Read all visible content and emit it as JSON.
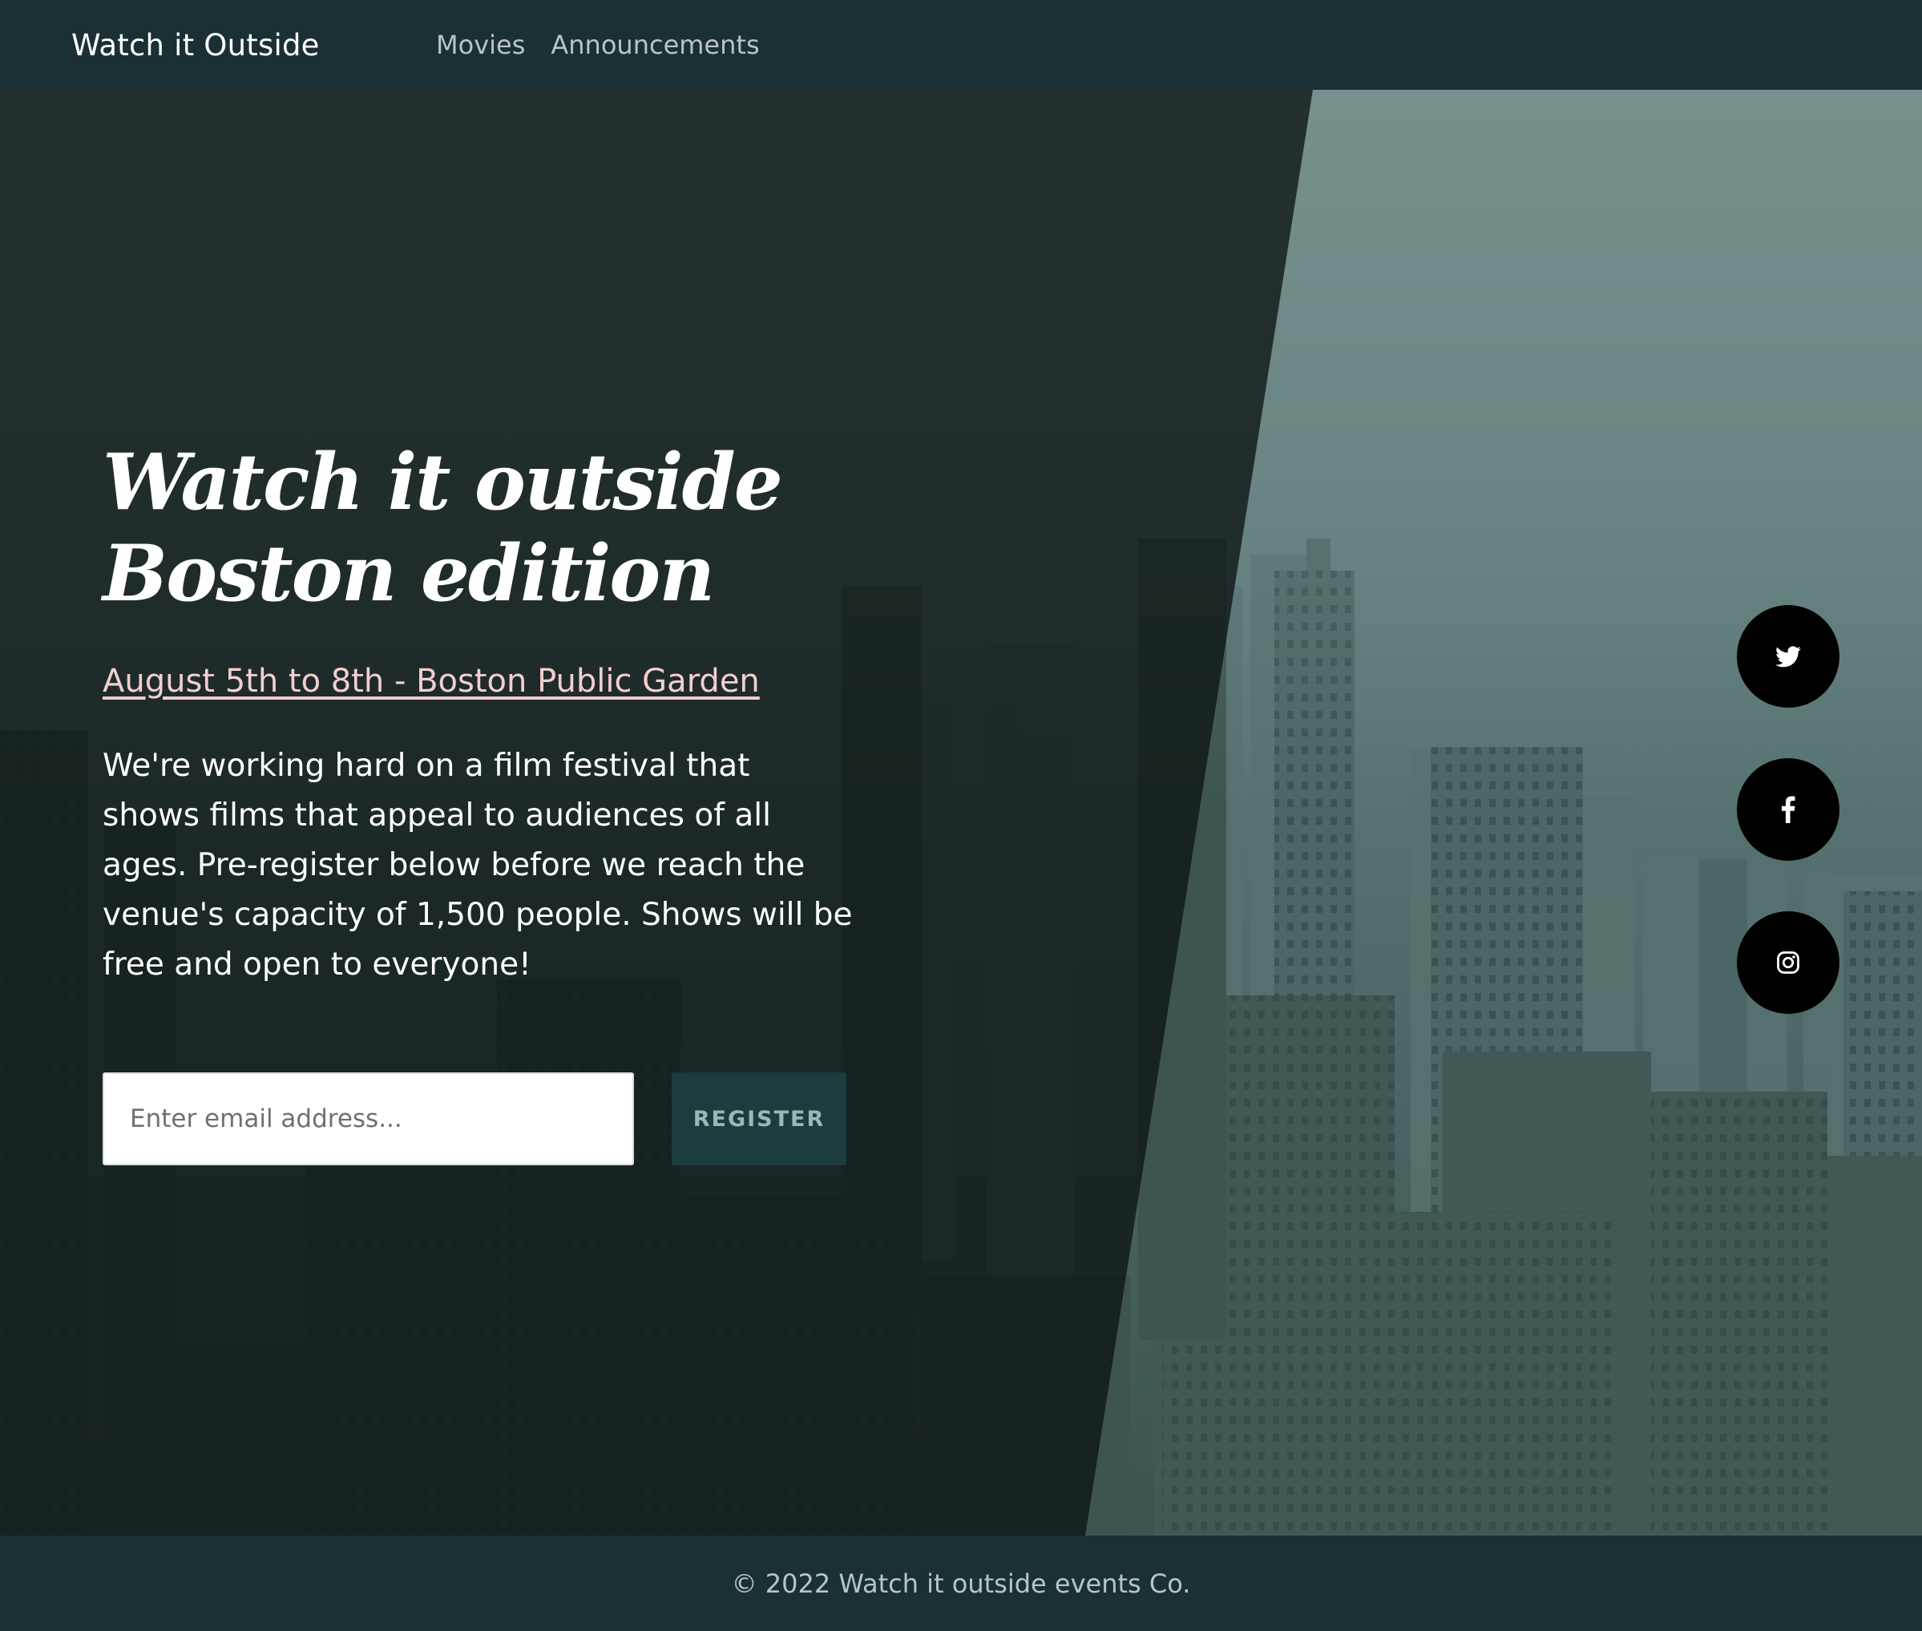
{
  "header": {
    "brand": "Watch it Outside",
    "nav": [
      {
        "label": "Movies"
      },
      {
        "label": "Announcements"
      }
    ]
  },
  "hero": {
    "title_line1": "Watch it outside",
    "title_line2": "Boston edition",
    "event_link": "August 5th to 8th - Boston Public Garden",
    "description": "We're working hard on a film festival that shows films that appeal to audiences of all ages. Pre-register below before we reach the venue's capacity of 1,500 people. Shows will be free and open to everyone!",
    "email_placeholder": "Enter email address...",
    "email_value": "",
    "register_label": "REGISTER"
  },
  "social": [
    {
      "icon": "twitter-icon"
    },
    {
      "icon": "facebook-icon"
    },
    {
      "icon": "instagram-icon"
    }
  ],
  "footer": {
    "copyright": "© 2022 Watch it outside events Co."
  },
  "colors": {
    "header_bg": "#1b3033",
    "link_pink": "#f1cfcf",
    "register_bg": "#1d3c3d",
    "social_bg": "#000000"
  }
}
